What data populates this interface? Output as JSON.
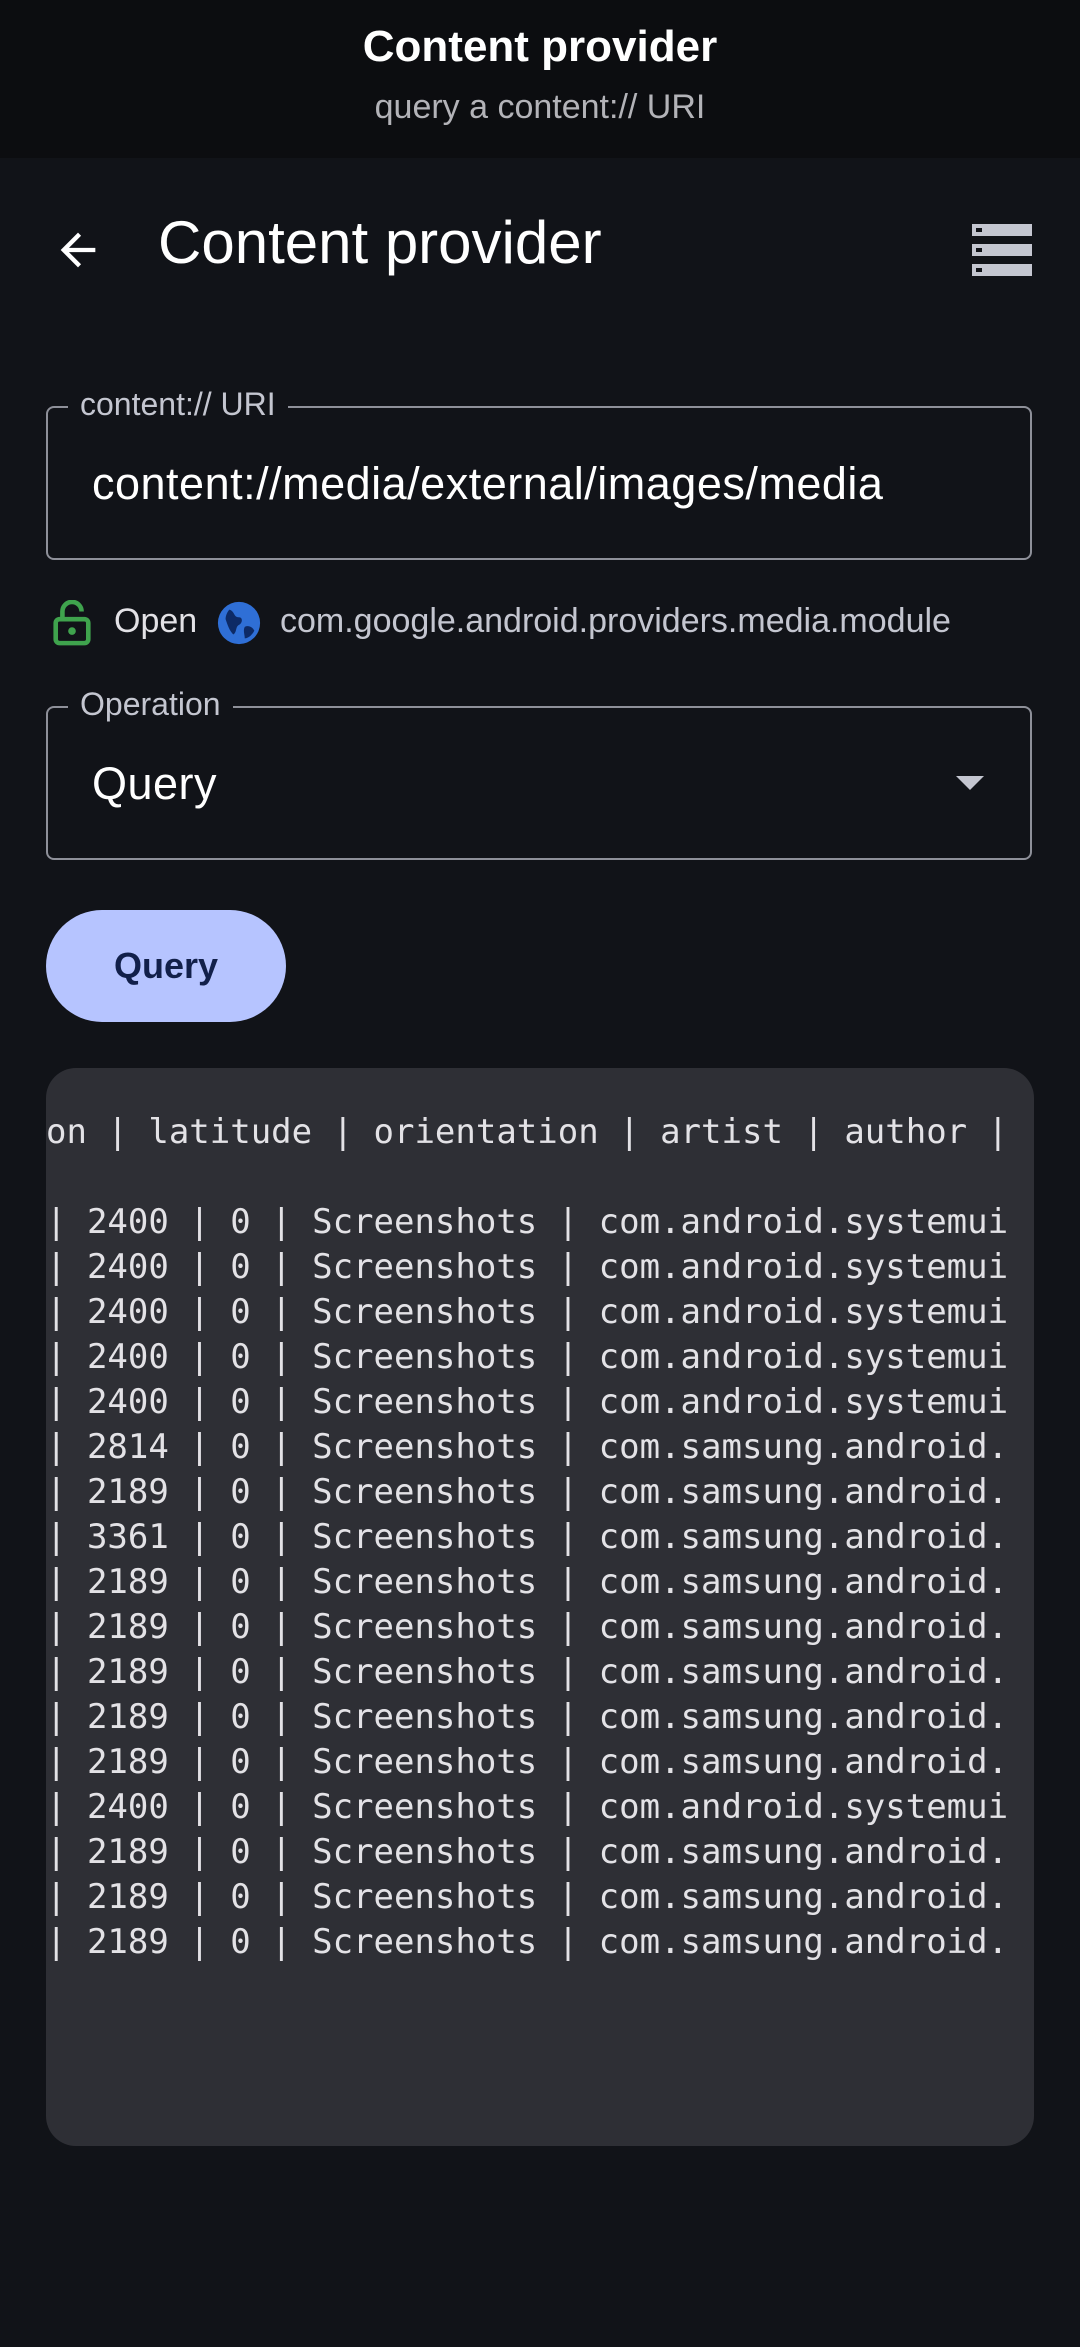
{
  "window": {
    "title": "Content provider",
    "subtitle": "query a content:// URI"
  },
  "appbar": {
    "title": "Content provider",
    "back_icon": "arrow-back-icon",
    "menu_icon": "list-view-icon"
  },
  "uri_field": {
    "label": "content:// URI",
    "value": "content://media/external/images/media"
  },
  "provider_info": {
    "access": "Open",
    "package": "com.google.android.providers.media.module",
    "lock_color": "#3fa34d",
    "globe_color": "#2f6fd6"
  },
  "operation_field": {
    "label": "Operation",
    "value": "Query"
  },
  "query_button": {
    "label": "Query"
  },
  "results": {
    "header": "on | latitude | orientation | artist | author | ",
    "rows": [
      "| 2400 | 0 | Screenshots | com.android.systemui",
      "| 2400 | 0 | Screenshots | com.android.systemui",
      "| 2400 | 0 | Screenshots | com.android.systemui",
      "| 2400 | 0 | Screenshots | com.android.systemui",
      "| 2400 | 0 | Screenshots | com.android.systemui",
      "| 2814 | 0 | Screenshots | com.samsung.android.",
      "| 2189 | 0 | Screenshots | com.samsung.android.",
      "| 3361 | 0 | Screenshots | com.samsung.android.",
      "| 2189 | 0 | Screenshots | com.samsung.android.",
      "| 2189 | 0 | Screenshots | com.samsung.android.",
      "| 2189 | 0 | Screenshots | com.samsung.android.",
      "| 2189 | 0 | Screenshots | com.samsung.android.",
      "| 2189 | 0 | Screenshots | com.samsung.android.",
      "| 2400 | 0 | Screenshots | com.android.systemui",
      "| 2189 | 0 | Screenshots | com.samsung.android.",
      "| 2189 | 0 | Screenshots | com.samsung.android.",
      "| 2189 | 0 | Screenshots | com.samsung.android."
    ]
  },
  "colors": {
    "background": "#111318",
    "header_background": "#0c0d10",
    "accent_button": "#b6c4ff",
    "results_background": "#2e2f35"
  }
}
